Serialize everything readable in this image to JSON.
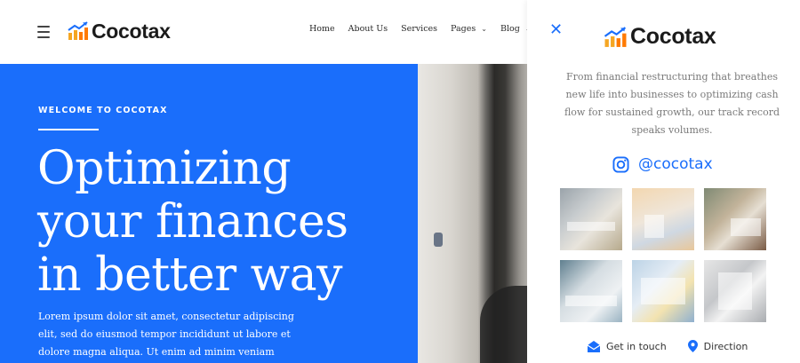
{
  "brand": {
    "name": "Cocotax",
    "accent": "#1a6efb",
    "logo_colors": [
      "#f5a623",
      "#ff7a00",
      "#1a6efb"
    ]
  },
  "header": {
    "menu_icon": "hamburger-menu-icon",
    "nav": [
      {
        "label": "Home",
        "has_dropdown": false
      },
      {
        "label": "About Us",
        "has_dropdown": false
      },
      {
        "label": "Services",
        "has_dropdown": false
      },
      {
        "label": "Pages",
        "has_dropdown": true
      },
      {
        "label": "Blog",
        "has_dropdown": true
      }
    ]
  },
  "hero": {
    "kicker": "WELCOME TO COCOTAX",
    "headline_lines": [
      "Optimizing",
      "your finances",
      "in better way"
    ],
    "body": "Lorem ipsum dolor sit amet, consectetur adipiscing elit, sed do eiusmod tempor incididunt ut labore et dolore magna aliqua. Ut enim ad minim veniam quis nostrud",
    "background": "#1a6efb"
  },
  "panel": {
    "close_icon": "close-icon",
    "description": "From financial restructuring that breathes new life into businesses to optimizing cash flow for sustained growth, our track record speaks volumes.",
    "instagram": {
      "icon": "instagram-icon",
      "handle": "@cocotax"
    },
    "gallery": [
      {
        "icon": "gallery-image-laptop-money"
      },
      {
        "icon": "gallery-image-calculator-documents"
      },
      {
        "icon": "gallery-image-charts-meeting"
      },
      {
        "icon": "gallery-image-coins-paperwork"
      },
      {
        "icon": "gallery-image-pen-document"
      },
      {
        "icon": "gallery-image-calculator"
      }
    ],
    "links": [
      {
        "label": "Get in touch",
        "icon": "envelope-icon"
      },
      {
        "label": "Direction",
        "icon": "map-pin-icon"
      }
    ]
  }
}
